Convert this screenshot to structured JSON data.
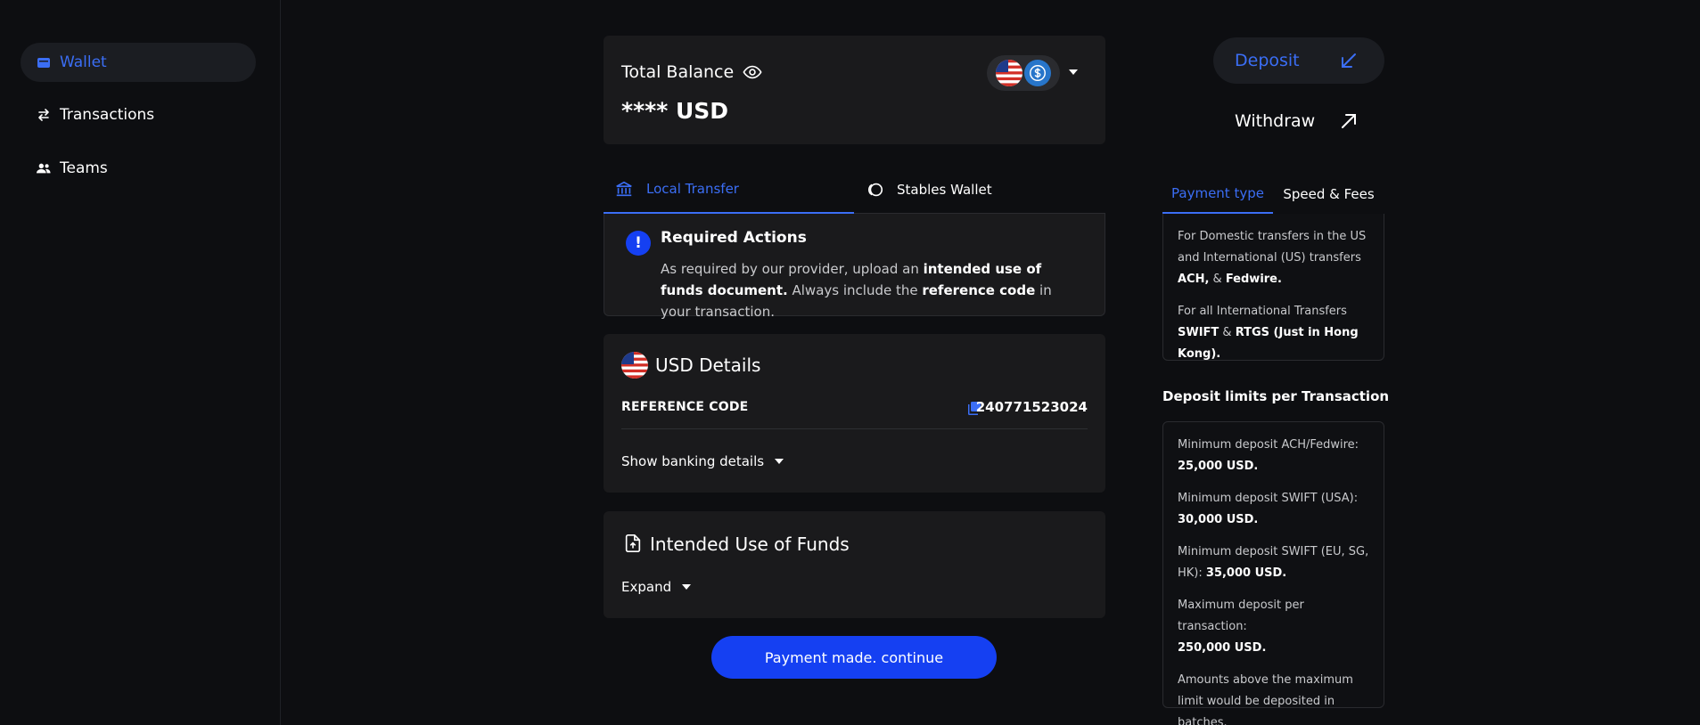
{
  "sidebar": {
    "items": [
      {
        "label": "Wallet",
        "icon": "wallet-icon",
        "active": true
      },
      {
        "label": "Transactions",
        "icon": "transfer-arrows-icon",
        "active": false
      },
      {
        "label": "Teams",
        "icon": "people-icon",
        "active": false
      }
    ]
  },
  "balance": {
    "title": "Total Balance",
    "amount": "**** USD"
  },
  "tabs": {
    "local": "Local Transfer",
    "stables": "Stables Wallet"
  },
  "required": {
    "title": "Required Actions",
    "text_1": "As required by our provider, upload an ",
    "bold_1": "intended use of funds document.",
    "text_2": " Always include the ",
    "bold_2": "reference code",
    "text_3": " in your transaction."
  },
  "usd_details": {
    "title": "USD Details",
    "reference_label": "REFERENCE CODE",
    "reference_value": "240771523024",
    "show_banking": "Show banking details"
  },
  "funds": {
    "title": "Intended Use of Funds",
    "expand": "Expand"
  },
  "continue_label": "Payment made. continue",
  "actions": {
    "deposit": "Deposit",
    "withdraw": "Withdraw"
  },
  "right_tabs": {
    "payment": "Payment type",
    "speed": "Speed & Fees"
  },
  "payment_info": {
    "p1_text": "For Domestic transfers in the US and International (US) transfers",
    "p1_bold_a": "ACH,",
    "p1_amp": " & ",
    "p1_bold_b": "Fedwire.",
    "p2_text": "For all International Transfers",
    "p2_bold_a": "SWIFT",
    "p2_amp": " & ",
    "p2_bold_b": "RTGS (Just in Hong Kong)."
  },
  "limits": {
    "title": "Deposit limits per Transaction",
    "items": [
      {
        "label": "Minimum deposit ACH/Fedwire:",
        "value": "25,000 USD."
      },
      {
        "label": "Minimum deposit SWIFT (USA):",
        "value": "30,000 USD."
      },
      {
        "label": "Minimum deposit SWIFT (EU, SG, HK):",
        "value": "35,000 USD."
      },
      {
        "label": "Maximum deposit per transaction:",
        "value": "250,000 USD."
      }
    ],
    "note": "Amounts above the maximum limit would be deposited in batches."
  },
  "colors": {
    "accent": "#3b6ef5",
    "primary_button": "#1540f2",
    "background": "#0d0e11",
    "card": "#1a1a1c"
  }
}
